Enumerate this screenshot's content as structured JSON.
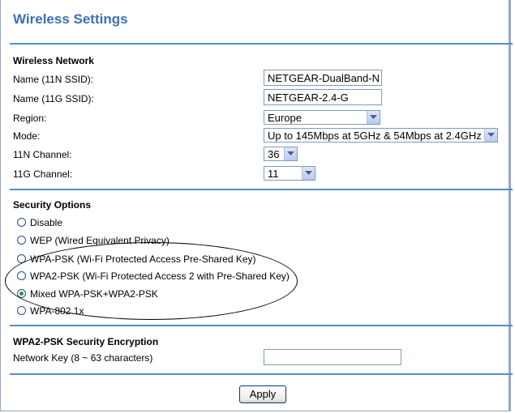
{
  "page": {
    "title": "Wireless Settings"
  },
  "wireless_network": {
    "heading": "Wireless Network",
    "ssid_11n_label": "Name (11N SSID):",
    "ssid_11n_value": "NETGEAR-DualBand-N",
    "ssid_11g_label": "Name (11G SSID):",
    "ssid_11g_value": "NETGEAR-2.4-G",
    "region_label": "Region:",
    "region_value": "Europe",
    "mode_label": "Mode:",
    "mode_value": "Up to 145Mbps at 5GHz & 54Mbps at 2.4GHz",
    "channel_11n_label": "11N Channel:",
    "channel_11n_value": "36",
    "channel_11g_label": "11G Channel:",
    "channel_11g_value": "11"
  },
  "security_options": {
    "heading": "Security Options",
    "options": [
      {
        "label": "Disable",
        "selected": false
      },
      {
        "label": "WEP (Wired Equivalent Privacy)",
        "selected": false
      },
      {
        "label": "WPA-PSK (Wi-Fi Protected Access Pre-Shared Key)",
        "selected": false
      },
      {
        "label": "WPA2-PSK (Wi-Fi Protected Access 2 with Pre-Shared Key)",
        "selected": false
      },
      {
        "label": "Mixed WPA-PSK+WPA2-PSK",
        "selected": true
      },
      {
        "label": "WPA-802.1x",
        "selected": false
      }
    ]
  },
  "encryption": {
    "heading": "WPA2-PSK Security Encryption",
    "network_key_label": "Network Key (8 ~ 63 characters)",
    "network_key_value": ""
  },
  "actions": {
    "apply_label": "Apply"
  },
  "colors": {
    "title": "#3d6fb5",
    "separator": "#4f8fc9",
    "radio_selected": "#21a121"
  },
  "icons": {
    "dropdown": "chevron-down-icon"
  }
}
